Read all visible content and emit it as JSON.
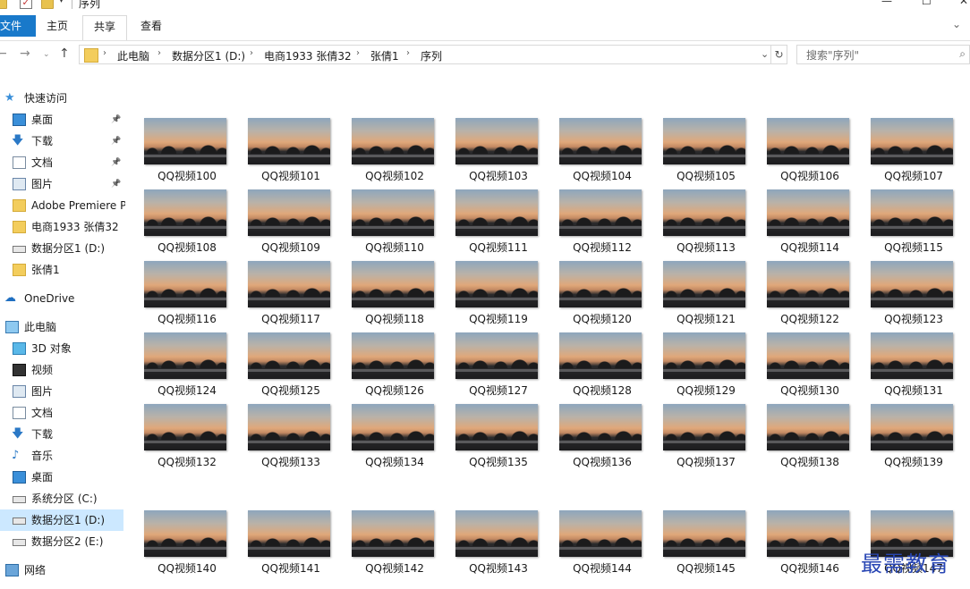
{
  "window": {
    "title": "序列"
  },
  "ribbon": {
    "tabs": [
      "文件",
      "主页",
      "共享",
      "查看"
    ]
  },
  "address": {
    "crumbs": [
      "此电脑",
      "数据分区1 (D:)",
      "电商1933 张倩32",
      "张倩1",
      "序列"
    ],
    "search_placeholder": "搜索\"序列\""
  },
  "sidebar": {
    "items": [
      {
        "label": "快速访问",
        "icon": "star-icon"
      },
      {
        "label": "桌面",
        "icon": "desktop-icon",
        "pinned": true
      },
      {
        "label": "下载",
        "icon": "download-icon",
        "pinned": true
      },
      {
        "label": "文档",
        "icon": "document-icon",
        "pinned": true
      },
      {
        "label": "图片",
        "icon": "picture-icon",
        "pinned": true
      },
      {
        "label": "Adobe Premiere P",
        "icon": "folder-icon"
      },
      {
        "label": "电商1933 张倩32",
        "icon": "folder-icon"
      },
      {
        "label": "数据分区1 (D:)",
        "icon": "drive-icon"
      },
      {
        "label": "张倩1",
        "icon": "folder-icon"
      },
      {
        "label": "OneDrive",
        "icon": "cloud-icon"
      },
      {
        "label": "此电脑",
        "icon": "computer-icon"
      },
      {
        "label": "3D 对象",
        "icon": "cube-icon"
      },
      {
        "label": "视频",
        "icon": "video-icon"
      },
      {
        "label": "图片",
        "icon": "picture-icon"
      },
      {
        "label": "文档",
        "icon": "document-icon"
      },
      {
        "label": "下载",
        "icon": "download-icon"
      },
      {
        "label": "音乐",
        "icon": "music-icon"
      },
      {
        "label": "桌面",
        "icon": "desktop-icon"
      },
      {
        "label": "系统分区 (C:)",
        "icon": "drive-icon"
      },
      {
        "label": "数据分区1 (D:)",
        "icon": "drive-icon",
        "selected": true
      },
      {
        "label": "数据分区2 (E:)",
        "icon": "drive-icon"
      },
      {
        "label": "网络",
        "icon": "network-icon"
      }
    ]
  },
  "files": [
    "QQ视频100",
    "QQ视频101",
    "QQ视频102",
    "QQ视频103",
    "QQ视频104",
    "QQ视频105",
    "QQ视频106",
    "QQ视频107",
    "QQ视频108",
    "QQ视频109",
    "QQ视频110",
    "QQ视频111",
    "QQ视频112",
    "QQ视频113",
    "QQ视频114",
    "QQ视频115",
    "QQ视频116",
    "QQ视频117",
    "QQ视频118",
    "QQ视频119",
    "QQ视频120",
    "QQ视频121",
    "QQ视频122",
    "QQ视频123",
    "QQ视频124",
    "QQ视频125",
    "QQ视频126",
    "QQ视频127",
    "QQ视频128",
    "QQ视频129",
    "QQ视频130",
    "QQ视频131",
    "QQ视频132",
    "QQ视频133",
    "QQ视频134",
    "QQ视频135",
    "QQ视频136",
    "QQ视频137",
    "QQ视频138",
    "QQ视频139",
    "QQ视频140",
    "QQ视频141",
    "QQ视频142",
    "QQ视频143",
    "QQ视频144",
    "QQ视频145",
    "QQ视频146",
    "QQ视频147"
  ],
  "watermark": "最需教育",
  "colors": {
    "accent": "#1979ca",
    "selected_bg": "#cce8ff",
    "watermark": "#2846b4"
  }
}
